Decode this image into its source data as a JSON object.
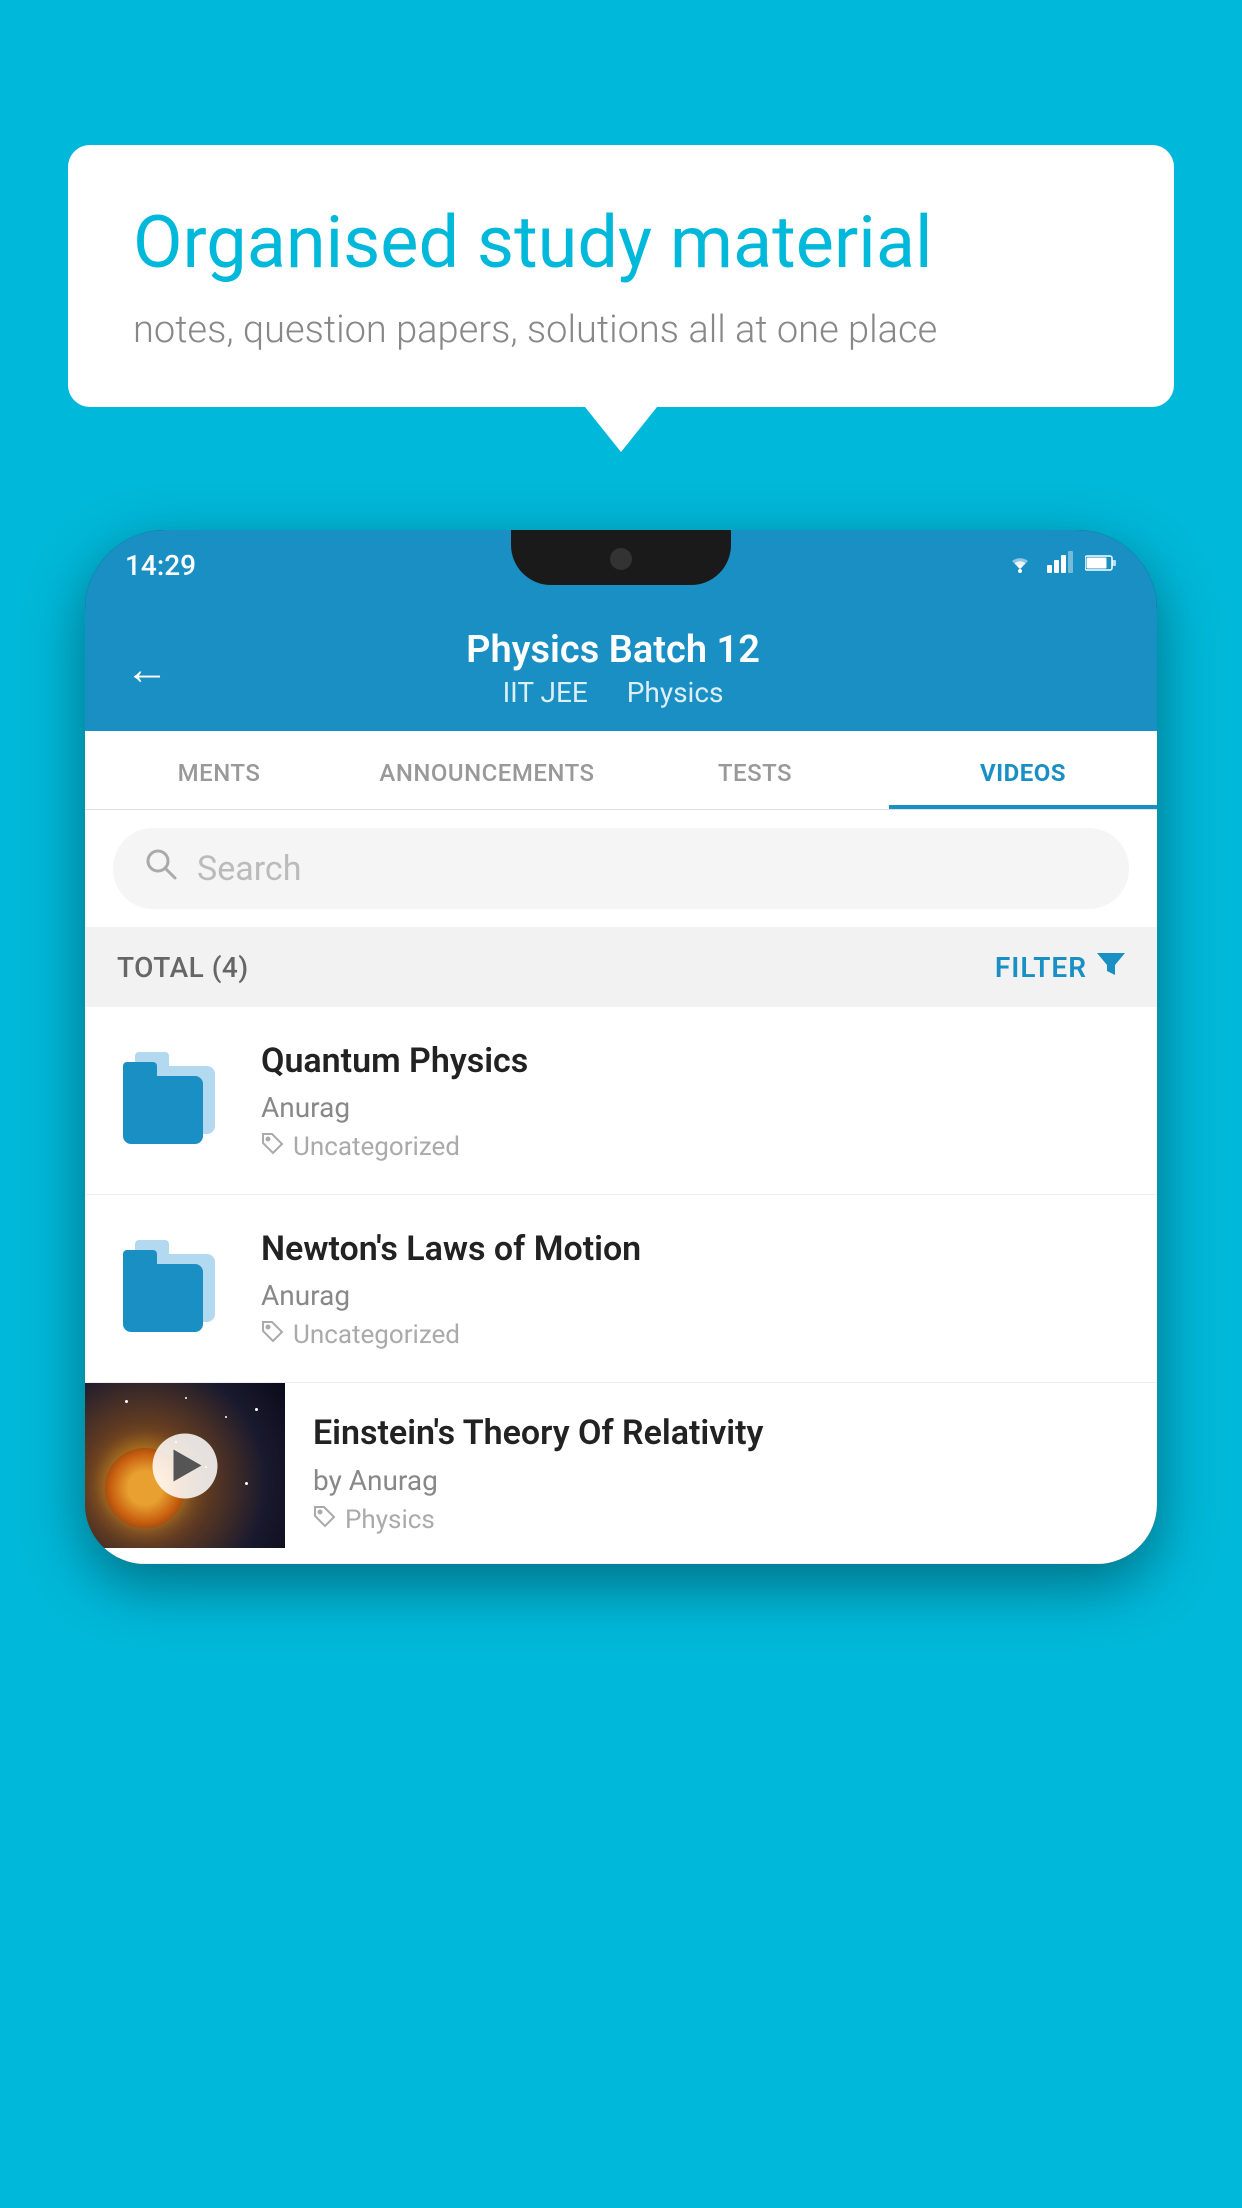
{
  "background_color": "#00B8D9",
  "speech_bubble": {
    "headline": "Organised study material",
    "subtext": "notes, question papers, solutions all at one place"
  },
  "status_bar": {
    "time": "14:29",
    "wifi_icon": "wifi",
    "signal_icon": "signal",
    "battery_icon": "battery"
  },
  "app_header": {
    "back_label": "←",
    "title": "Physics Batch 12",
    "subtitle_part1": "IIT JEE",
    "subtitle_part2": "Physics"
  },
  "tabs": [
    {
      "label": "MENTS",
      "active": false
    },
    {
      "label": "ANNOUNCEMENTS",
      "active": false
    },
    {
      "label": "TESTS",
      "active": false
    },
    {
      "label": "VIDEOS",
      "active": true
    }
  ],
  "search": {
    "placeholder": "Search"
  },
  "filter_row": {
    "total_label": "TOTAL (4)",
    "filter_label": "FILTER"
  },
  "videos": [
    {
      "title": "Quantum Physics",
      "author": "Anurag",
      "tag": "Uncategorized",
      "type": "folder"
    },
    {
      "title": "Newton's Laws of Motion",
      "author": "Anurag",
      "tag": "Uncategorized",
      "type": "folder"
    },
    {
      "title": "Einstein's Theory Of Relativity",
      "author": "by Anurag",
      "tag": "Physics",
      "type": "video"
    }
  ]
}
